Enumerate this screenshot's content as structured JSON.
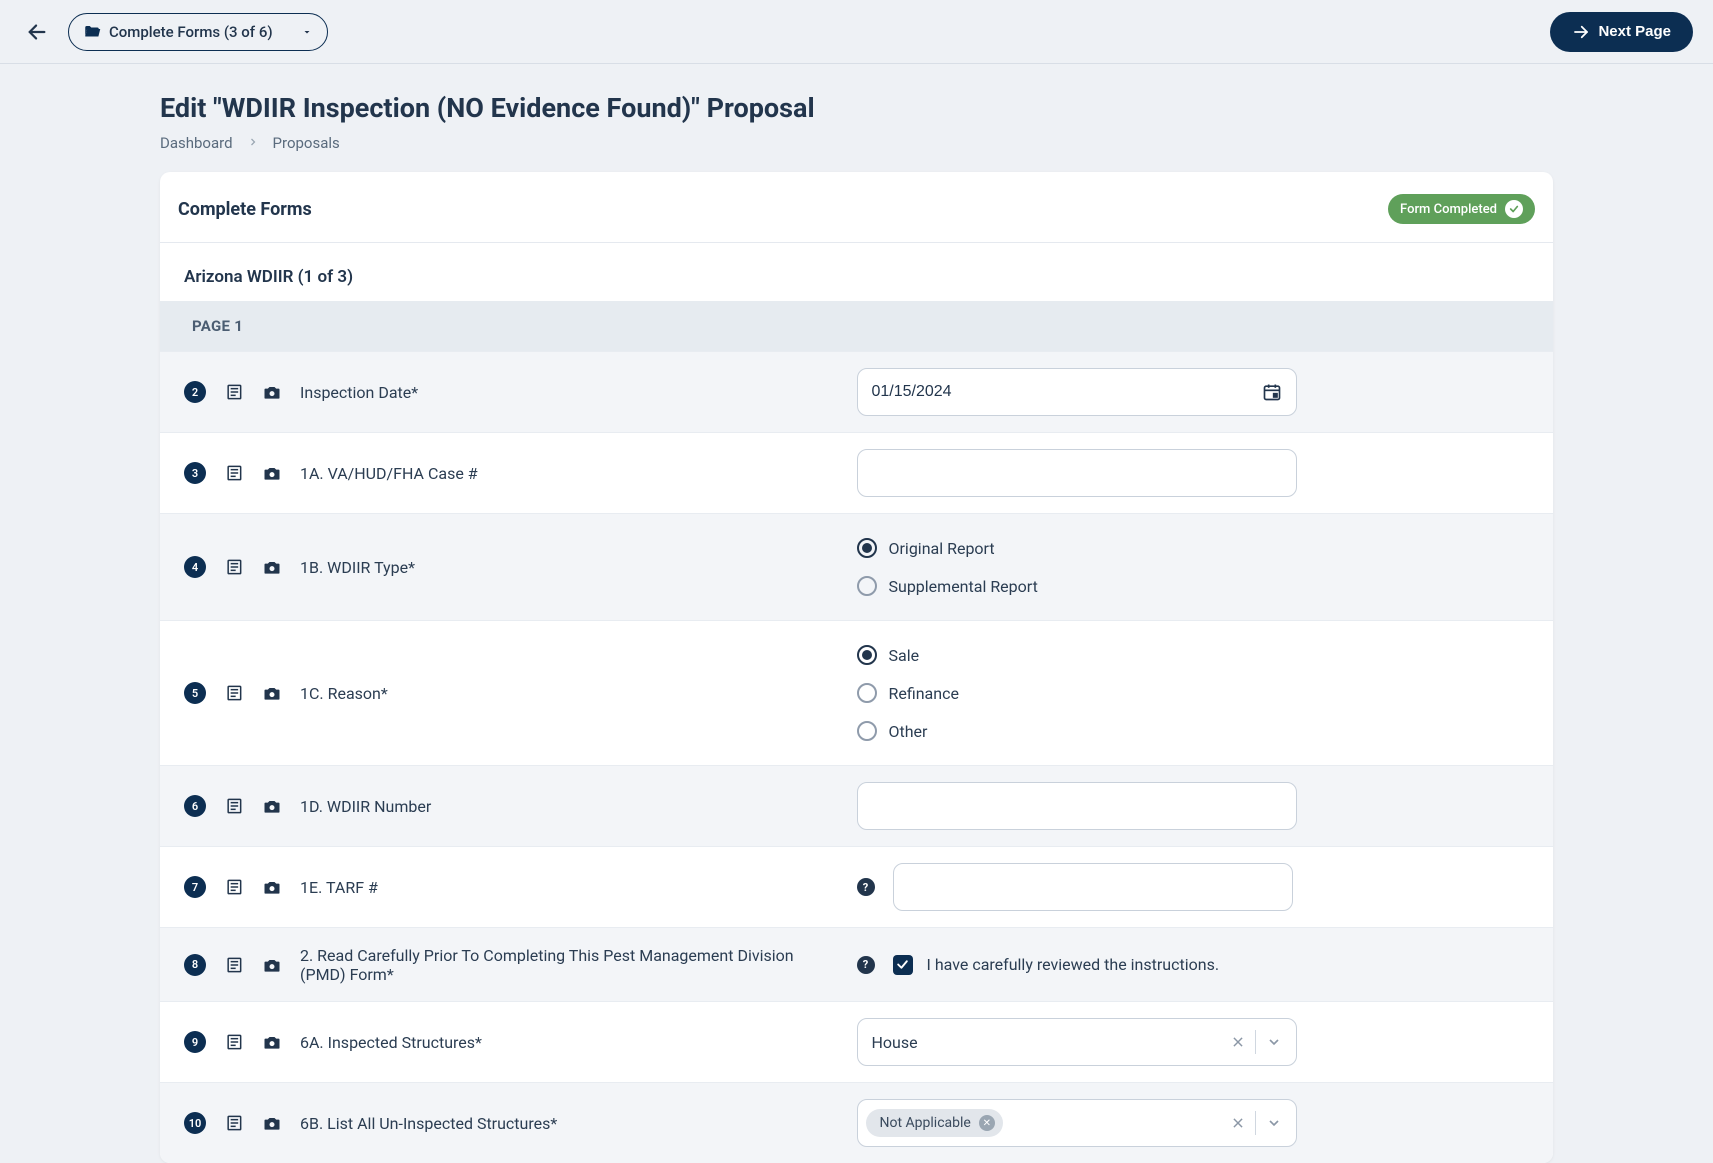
{
  "topbar": {
    "step_label": "Complete Forms (3 of 6)",
    "next_label": "Next Page"
  },
  "page": {
    "title": "Edit \"WDIIR Inspection (NO Evidence Found)\" Proposal",
    "breadcrumb": {
      "dashboard": "Dashboard",
      "proposals": "Proposals"
    }
  },
  "card": {
    "title": "Complete Forms",
    "status": "Form Completed",
    "subhead": "Arizona WDIIR (1 of 3)",
    "page_label": "PAGE 1"
  },
  "rows": {
    "r2": {
      "num": "2",
      "label": "Inspection Date*",
      "value": "01/15/2024"
    },
    "r3": {
      "num": "3",
      "label": "1A. VA/HUD/FHA Case #",
      "value": ""
    },
    "r4": {
      "num": "4",
      "label": "1B. WDIIR Type*",
      "opt1": "Original Report",
      "opt2": "Supplemental Report"
    },
    "r5": {
      "num": "5",
      "label": "1C. Reason*",
      "opt1": "Sale",
      "opt2": "Refinance",
      "opt3": "Other"
    },
    "r6": {
      "num": "6",
      "label": "1D. WDIIR Number",
      "value": ""
    },
    "r7": {
      "num": "7",
      "label": "1E. TARF #",
      "value": ""
    },
    "r8": {
      "num": "8",
      "label": "2. Read Carefully Prior To Completing This Pest Management Division (PMD) Form*",
      "check_label": "I have carefully reviewed the instructions."
    },
    "r9": {
      "num": "9",
      "label": "6A. Inspected Structures*",
      "value": "House"
    },
    "r10": {
      "num": "10",
      "label": "6B. List All Un-Inspected Structures*",
      "tag": "Not Applicable"
    }
  },
  "chart_data": null
}
